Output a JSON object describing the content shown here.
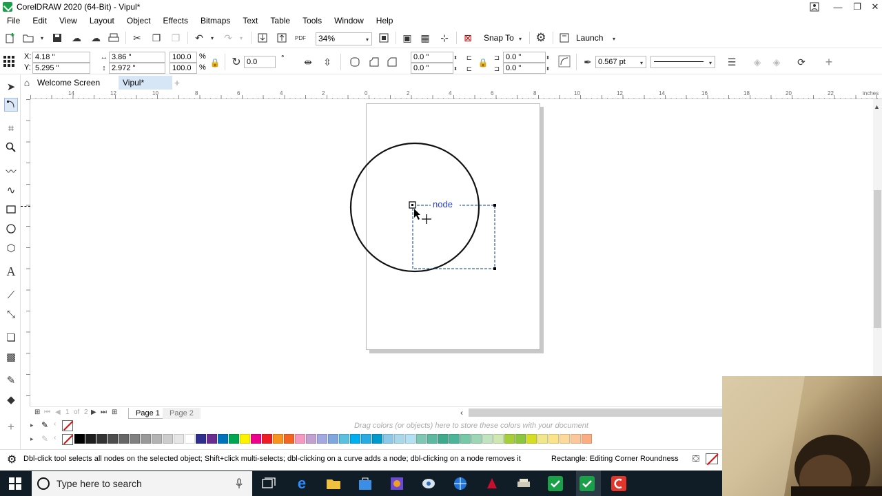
{
  "window": {
    "title": "CorelDRAW 2020 (64-Bit) - Vipul*",
    "minimize_glyph": "—",
    "restore_glyph": "❐",
    "close_glyph": "✕"
  },
  "menu": [
    "File",
    "Edit",
    "View",
    "Layout",
    "Object",
    "Effects",
    "Bitmaps",
    "Text",
    "Table",
    "Tools",
    "Window",
    "Help"
  ],
  "standard_toolbar": {
    "zoom": "34%",
    "snap_to": "Snap To",
    "launch": "Launch",
    "pdf_label": "PDF"
  },
  "property_bar": {
    "x_label": "X:",
    "x": "4.18 \"",
    "y_label": "Y:",
    "y": "5.295 \"",
    "width": "3.86 \"",
    "height": "2.972 \"",
    "scale_w": "100.0",
    "scale_h": "100.0",
    "percent": "%",
    "rotation": "0.0",
    "degree": "°",
    "corner_tl": "0.0 \"",
    "corner_bl": "0.0 \"",
    "corner_tr": "0.0 \"",
    "corner_br": "0.0 \"",
    "outline_width": "0.567 pt"
  },
  "doc_tabs": [
    {
      "label": "Welcome Screen",
      "active": false
    },
    {
      "label": "Vipul*",
      "active": true
    }
  ],
  "ruler": {
    "units": "inches",
    "labels": [
      "14",
      "12",
      "10",
      "8",
      "6",
      "4",
      "2",
      "0",
      "2",
      "4",
      "6",
      "8",
      "10",
      "12",
      "14",
      "16",
      "18",
      "20",
      "22"
    ]
  },
  "canvas": {
    "node_tooltip": "node"
  },
  "page_nav": {
    "current": "1",
    "of": "of",
    "total": "2",
    "pages": [
      "Page 1",
      "Page 2"
    ]
  },
  "palette": {
    "drop_hint": "Drag colors (or objects) here to store these colors with your document",
    "colors": [
      "#000000",
      "#1e1e1e",
      "#333333",
      "#4d4d4d",
      "#666666",
      "#808080",
      "#999999",
      "#b3b3b3",
      "#cccccc",
      "#e6e6e6",
      "#ffffff",
      "#2e2e8f",
      "#6a2c8f",
      "#0072bc",
      "#00a651",
      "#fff200",
      "#ec008c",
      "#ed1c24",
      "#f7941d",
      "#f26522",
      "#f49ac1",
      "#c2a0d0",
      "#a3a8e0",
      "#7fa7de",
      "#5bc0de",
      "#00aeef",
      "#29abe2",
      "#0099cc",
      "#8dc8e8",
      "#a8d8ea",
      "#b3e0f2",
      "#7fc7b3",
      "#5cb8a0",
      "#3fa98b",
      "#4bb59a",
      "#76c9a6",
      "#9dd6b5",
      "#c0e3c0",
      "#cfe8b0",
      "#a6ce39",
      "#8cc63f",
      "#d6de23",
      "#f0e68c",
      "#fbe38a",
      "#fdd99b",
      "#fcc89b",
      "#f9ad81"
    ]
  },
  "status": {
    "hint": "Dbl-click tool selects all nodes on the selected object; Shift+click multi-selects; dbl-clicking on a curve adds a node; dbl-clicking on a node removes it",
    "object_info": "Rectangle: Editing Corner Roundness"
  },
  "taskbar": {
    "search_placeholder": "Type here to search"
  },
  "colors": {
    "accent": "#1ba04a",
    "selection": "#0a3d91",
    "taskbar": "#101d26"
  }
}
